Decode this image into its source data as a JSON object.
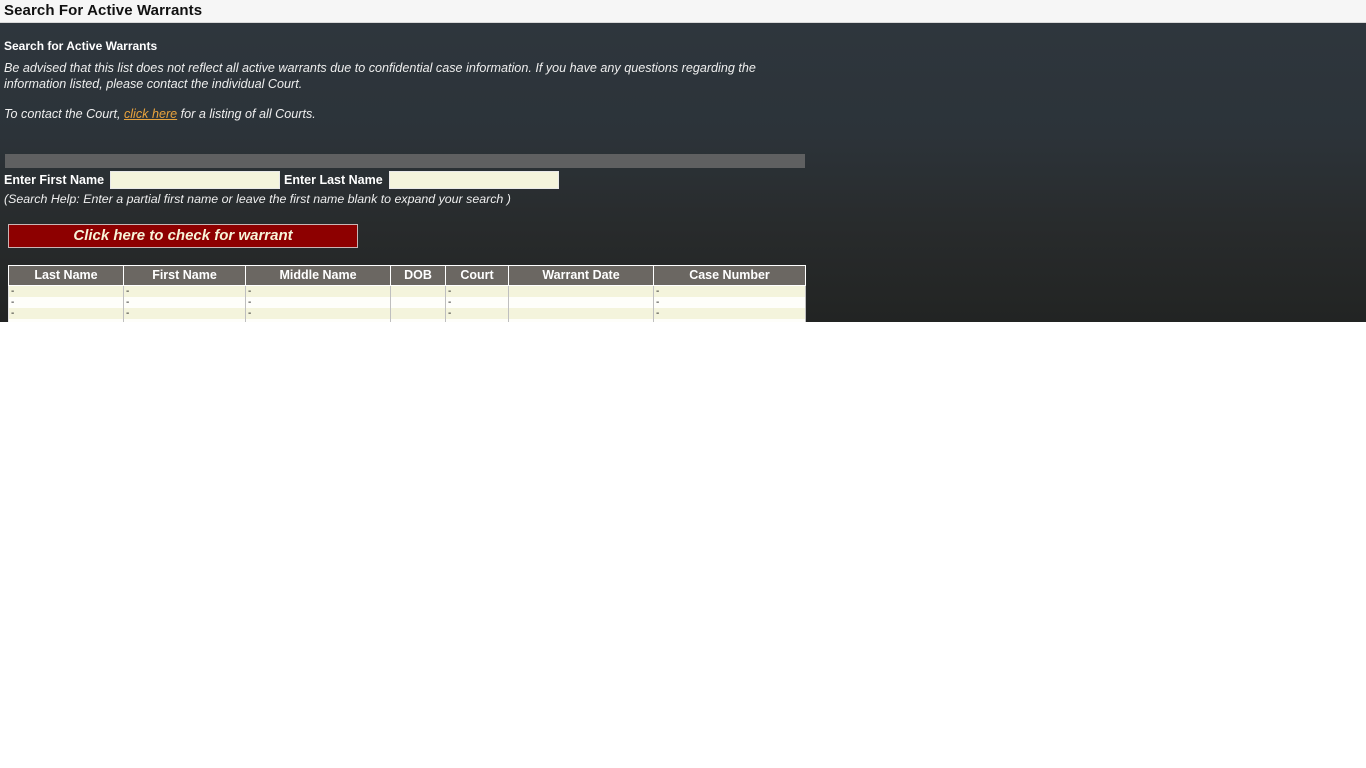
{
  "topbar": {
    "title": "Search For Active Warrants"
  },
  "panel": {
    "heading": "Search for Active Warrants",
    "advisory": "Be advised that this list does not reflect all active warrants due to confidential case information. If you have any questions regarding the information listed, please contact the individual Court.",
    "contact_prefix": "To contact the Court, ",
    "contact_link": "click here",
    "contact_suffix": " for a listing of all Courts.",
    "search_help": "(Search Help: Enter a partial first name or leave the first name blank to expand your search )"
  },
  "form": {
    "first_name_label": "Enter First Name",
    "first_name_value": "",
    "first_name_placeholder": "",
    "last_name_label": "Enter Last Name",
    "last_name_value": "",
    "last_name_placeholder": "",
    "submit_label": "Click here to check for warrant"
  },
  "results": {
    "columns": [
      "Last Name",
      "First Name",
      "Middle Name",
      "DOB",
      "Court",
      "Warrant Date",
      "Case Number"
    ],
    "rows": [
      {
        "last": "-",
        "first": "-",
        "middle": "-",
        "dob": "",
        "court": "-",
        "warrant_date": "",
        "case_number": "-"
      },
      {
        "last": "-",
        "first": "-",
        "middle": "-",
        "dob": "",
        "court": "-",
        "warrant_date": "",
        "case_number": "-"
      },
      {
        "last": "-",
        "first": "-",
        "middle": "-",
        "dob": "",
        "court": "-",
        "warrant_date": "",
        "case_number": "-"
      },
      {
        "last": "-",
        "first": "-",
        "middle": "-",
        "dob": "",
        "court": "-",
        "warrant_date": "",
        "case_number": "-"
      }
    ],
    "footer_row": {
      "last": "",
      "first": "",
      "middle": "",
      "dob": "",
      "court": "",
      "warrant_date": "",
      "case_number": ""
    }
  },
  "colors": {
    "panel_top": "#2e363d",
    "panel_bottom": "#222423",
    "link": "#e8a33d",
    "button_bg": "#8d0000",
    "button_text": "#f7f3d8",
    "input_bg": "#f4f4dc",
    "table_header_bg": "#6b6762",
    "row_odd_bg": "#f4f4dc",
    "row_even_bg": "#fefefa",
    "footer_row_bg": "#cecc96",
    "divider_bg": "#5f6061"
  }
}
